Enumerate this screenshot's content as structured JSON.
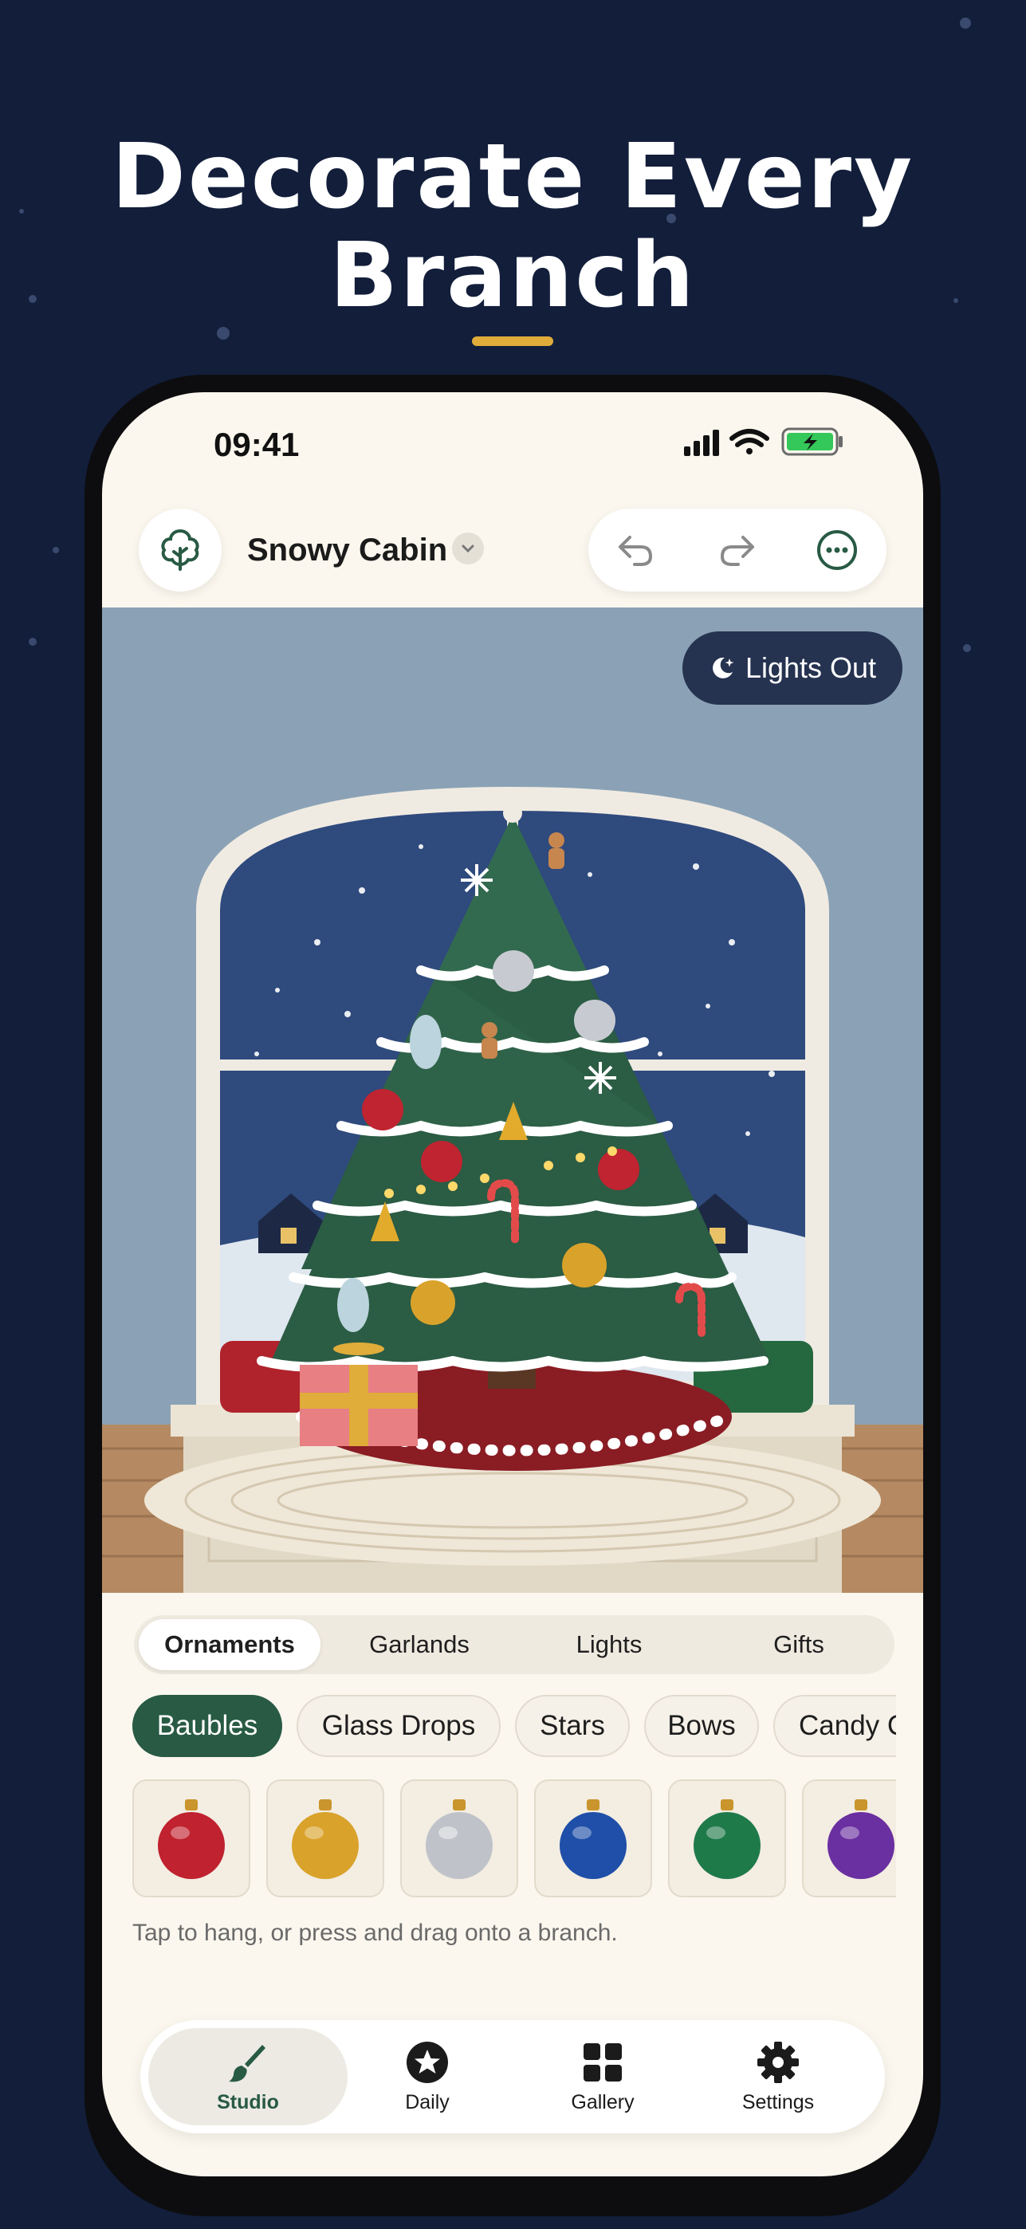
{
  "headline": {
    "line1": "Decorate Every",
    "line2": "Branch"
  },
  "status_bar": {
    "time": "09:41"
  },
  "header": {
    "project_title": "Snowy Cabin"
  },
  "scene": {
    "lights_out_label": "Lights Out"
  },
  "segments": [
    {
      "label": "Ornaments",
      "active": true
    },
    {
      "label": "Garlands",
      "active": false
    },
    {
      "label": "Lights",
      "active": false
    },
    {
      "label": "Gifts",
      "active": false
    }
  ],
  "chips": [
    {
      "label": "Baubles",
      "active": true
    },
    {
      "label": "Glass Drops",
      "active": false
    },
    {
      "label": "Stars",
      "active": false
    },
    {
      "label": "Bows",
      "active": false
    },
    {
      "label": "Candy Canes",
      "active": false
    }
  ],
  "swatches": [
    {
      "name": "red-bauble",
      "color": "#c0222f"
    },
    {
      "name": "gold-bauble",
      "color": "#d9a22a"
    },
    {
      "name": "silver-bauble",
      "color": "#bfc3c9"
    },
    {
      "name": "blue-bauble",
      "color": "#1f4fa8"
    },
    {
      "name": "green-bauble",
      "color": "#1f7a4a"
    },
    {
      "name": "purple-bauble",
      "color": "#6a2fa0"
    }
  ],
  "hint": "Tap to hang, or press and drag onto a branch.",
  "tabs": [
    {
      "label": "Studio",
      "icon": "brush-icon",
      "active": true
    },
    {
      "label": "Daily",
      "icon": "star-icon",
      "active": false
    },
    {
      "label": "Gallery",
      "icon": "grid-icon",
      "active": false
    },
    {
      "label": "Settings",
      "icon": "gear-icon",
      "active": false
    }
  ],
  "colors": {
    "accent": "#285a44",
    "background": "#121e3a",
    "headline_accent": "#e0ac3a"
  }
}
